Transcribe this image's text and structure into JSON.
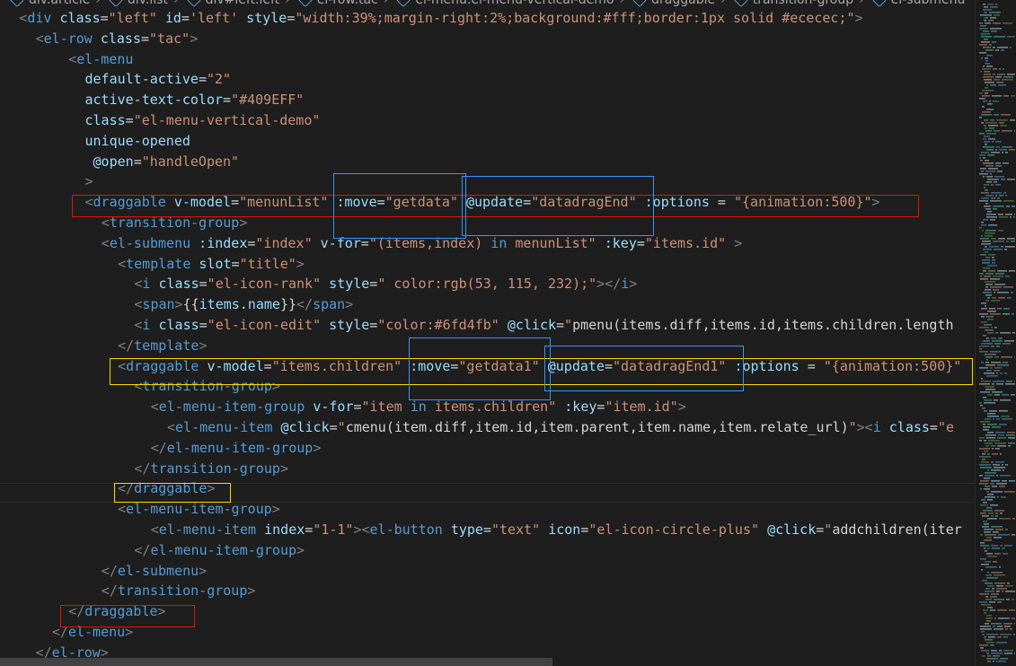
{
  "breadcrumb": [
    "div.article",
    "div.list",
    "div#left.left",
    "el-row.tac",
    "el-menu.el-menu-vertical-demo",
    "draggable",
    "transition-group",
    "el-submenu"
  ],
  "colors": {
    "tag": "#569cd6",
    "attr": "#9cdcfe",
    "string": "#ce9178",
    "punct": "#808080",
    "text": "#d4d4d4",
    "highlight_red": "#e51400",
    "highlight_blue": "#3794ff",
    "highlight_yellow": "#ffd700"
  },
  "code": [
    {
      "i": 1,
      "tokens": [
        [
          "p",
          "<"
        ],
        [
          "t",
          "div"
        ],
        [
          "d",
          " "
        ],
        [
          "a",
          "class"
        ],
        [
          "d",
          "="
        ],
        [
          "s",
          "\"left\""
        ],
        [
          "d",
          " "
        ],
        [
          "a",
          "id"
        ],
        [
          "d",
          "="
        ],
        [
          "s",
          "'left'"
        ],
        [
          "d",
          " "
        ],
        [
          "a",
          "style"
        ],
        [
          "d",
          "="
        ],
        [
          "s",
          "\"width:39%;margin-right:2%;background:#fff;border:1px solid #ececec;\""
        ],
        [
          "p",
          ">"
        ]
      ]
    },
    {
      "i": 2,
      "tokens": [
        [
          "p",
          "<"
        ],
        [
          "t",
          "el-row"
        ],
        [
          "d",
          " "
        ],
        [
          "a",
          "class"
        ],
        [
          "d",
          "="
        ],
        [
          "s",
          "\"tac\""
        ],
        [
          "p",
          ">"
        ]
      ]
    },
    {
      "i": 4,
      "tokens": [
        [
          "p",
          "<"
        ],
        [
          "t",
          "el-menu"
        ]
      ]
    },
    {
      "i": 5,
      "tokens": [
        [
          "a",
          "default-active"
        ],
        [
          "d",
          "="
        ],
        [
          "s",
          "\"2\""
        ]
      ]
    },
    {
      "i": 5,
      "tokens": [
        [
          "a",
          "active-text-color"
        ],
        [
          "d",
          "="
        ],
        [
          "s",
          "\"#409EFF\""
        ]
      ]
    },
    {
      "i": 5,
      "tokens": [
        [
          "a",
          "class"
        ],
        [
          "d",
          "="
        ],
        [
          "s",
          "\"el-menu-vertical-demo\""
        ]
      ]
    },
    {
      "i": 5,
      "tokens": [
        [
          "a",
          "unique-opened"
        ]
      ]
    },
    {
      "i": 5,
      "tokens": [
        [
          "d",
          " "
        ],
        [
          "a",
          "@open"
        ],
        [
          "d",
          "="
        ],
        [
          "s",
          "\"handleOpen\""
        ]
      ]
    },
    {
      "i": 5,
      "tokens": [
        [
          "p",
          ">"
        ]
      ]
    },
    {
      "i": 5,
      "tokens": [
        [
          "p",
          "<"
        ],
        [
          "t",
          "draggable"
        ],
        [
          "d",
          " "
        ],
        [
          "a",
          "v-model"
        ],
        [
          "d",
          "="
        ],
        [
          "s",
          "\"menunList\""
        ],
        [
          "d",
          " "
        ],
        [
          "a",
          ":move"
        ],
        [
          "d",
          "="
        ],
        [
          "s",
          "\"getdata\""
        ],
        [
          "d",
          " "
        ],
        [
          "a",
          "@update"
        ],
        [
          "d",
          "="
        ],
        [
          "s",
          "\"datadragEnd\""
        ],
        [
          "d",
          " "
        ],
        [
          "a",
          ":options"
        ],
        [
          "d",
          " = "
        ],
        [
          "s",
          "\"{animation:500}\""
        ],
        [
          "p",
          ">"
        ]
      ]
    },
    {
      "i": 6,
      "tokens": [
        [
          "p",
          "<"
        ],
        [
          "t",
          "transition-group"
        ],
        [
          "p",
          ">"
        ]
      ]
    },
    {
      "i": 6,
      "tokens": [
        [
          "p",
          "<"
        ],
        [
          "t",
          "el-submenu"
        ],
        [
          "d",
          " "
        ],
        [
          "a",
          ":index"
        ],
        [
          "d",
          "="
        ],
        [
          "s",
          "\"index\""
        ],
        [
          "d",
          " "
        ],
        [
          "a",
          "v-for"
        ],
        [
          "d",
          "="
        ],
        [
          "s",
          "\"(items,index) "
        ],
        [
          "t",
          "in"
        ],
        [
          "s",
          " menunList\""
        ],
        [
          "d",
          " "
        ],
        [
          "a",
          ":key"
        ],
        [
          "d",
          "="
        ],
        [
          "s",
          "\"items.id\""
        ],
        [
          "d",
          " "
        ],
        [
          "p",
          ">"
        ]
      ]
    },
    {
      "i": 7,
      "tokens": [
        [
          "p",
          "<"
        ],
        [
          "t",
          "template"
        ],
        [
          "d",
          " "
        ],
        [
          "a",
          "slot"
        ],
        [
          "d",
          "="
        ],
        [
          "s",
          "\"title\""
        ],
        [
          "p",
          ">"
        ]
      ]
    },
    {
      "i": 8,
      "tokens": [
        [
          "p",
          "<"
        ],
        [
          "t",
          "i"
        ],
        [
          "d",
          " "
        ],
        [
          "a",
          "class"
        ],
        [
          "d",
          "="
        ],
        [
          "s",
          "\"el-icon-rank\""
        ],
        [
          "d",
          " "
        ],
        [
          "a",
          "style"
        ],
        [
          "d",
          "="
        ],
        [
          "s",
          "\" color:rgb(53, 115, 232);\""
        ],
        [
          "p",
          "></"
        ],
        [
          "t",
          "i"
        ],
        [
          "p",
          ">"
        ]
      ]
    },
    {
      "i": 8,
      "tokens": [
        [
          "p",
          "<"
        ],
        [
          "t",
          "span"
        ],
        [
          "p",
          ">"
        ],
        [
          "d",
          "{{"
        ],
        [
          "a",
          "items.name"
        ],
        [
          "d",
          "}}"
        ],
        [
          "p",
          "</"
        ],
        [
          "t",
          "span"
        ],
        [
          "p",
          ">"
        ]
      ]
    },
    {
      "i": 8,
      "tokens": [
        [
          "p",
          "<"
        ],
        [
          "t",
          "i"
        ],
        [
          "d",
          " "
        ],
        [
          "a",
          "class"
        ],
        [
          "d",
          "="
        ],
        [
          "s",
          "\"el-icon-edit\""
        ],
        [
          "d",
          " "
        ],
        [
          "a",
          "style"
        ],
        [
          "d",
          "="
        ],
        [
          "s",
          "\"color:#6fd4fb\""
        ],
        [
          "d",
          " "
        ],
        [
          "a",
          "@click"
        ],
        [
          "d",
          "="
        ],
        [
          "s",
          "\""
        ],
        [
          "d",
          "pmenu(items.diff,items.id,items.children.length"
        ]
      ]
    },
    {
      "i": 7,
      "tokens": [
        [
          "p",
          "</"
        ],
        [
          "t",
          "template"
        ],
        [
          "p",
          ">"
        ]
      ]
    },
    {
      "i": 7,
      "tokens": [
        [
          "p",
          "<"
        ],
        [
          "t",
          "draggable"
        ],
        [
          "d",
          " "
        ],
        [
          "a",
          "v-model"
        ],
        [
          "d",
          "="
        ],
        [
          "s",
          "\"items.children\""
        ],
        [
          "d",
          " "
        ],
        [
          "a",
          ":move"
        ],
        [
          "d",
          "="
        ],
        [
          "s",
          "\"getdata1\""
        ],
        [
          "d",
          " "
        ],
        [
          "a",
          "@update"
        ],
        [
          "d",
          "="
        ],
        [
          "s",
          "\"datadragEnd1\""
        ],
        [
          "d",
          " "
        ],
        [
          "a",
          ":options"
        ],
        [
          "d",
          " = "
        ],
        [
          "s",
          "\"{animation:500}\""
        ]
      ]
    },
    {
      "i": 8,
      "tokens": [
        [
          "p",
          "<"
        ],
        [
          "t",
          "transition-group"
        ],
        [
          "p",
          ">"
        ]
      ]
    },
    {
      "i": 9,
      "tokens": [
        [
          "p",
          "<"
        ],
        [
          "t",
          "el-menu-item-group"
        ],
        [
          "d",
          " "
        ],
        [
          "a",
          "v-for"
        ],
        [
          "d",
          "="
        ],
        [
          "s",
          "\"item "
        ],
        [
          "t",
          "in"
        ],
        [
          "s",
          " items.children\""
        ],
        [
          "d",
          " "
        ],
        [
          "a",
          ":key"
        ],
        [
          "d",
          "="
        ],
        [
          "s",
          "\"item.id\""
        ],
        [
          "p",
          ">"
        ]
      ]
    },
    {
      "i": 10,
      "tokens": [
        [
          "p",
          "<"
        ],
        [
          "t",
          "el-menu-item"
        ],
        [
          "d",
          " "
        ],
        [
          "a",
          "@click"
        ],
        [
          "d",
          "="
        ],
        [
          "s",
          "\""
        ],
        [
          "d",
          "cmenu(item.diff,item.id,item.parent,item.name,item.relate_url)"
        ],
        [
          "s",
          "\""
        ],
        [
          "p",
          "><"
        ],
        [
          "t",
          "i"
        ],
        [
          "d",
          " "
        ],
        [
          "a",
          "class"
        ],
        [
          "d",
          "="
        ],
        [
          "s",
          "\"e"
        ]
      ]
    },
    {
      "i": 9,
      "tokens": [
        [
          "p",
          "</"
        ],
        [
          "t",
          "el-menu-item-group"
        ],
        [
          "p",
          ">"
        ]
      ]
    },
    {
      "i": 8,
      "tokens": [
        [
          "p",
          "</"
        ],
        [
          "t",
          "transition-group"
        ],
        [
          "p",
          ">"
        ]
      ]
    },
    {
      "i": 7,
      "tokens": [
        [
          "p",
          "</"
        ],
        [
          "t",
          "draggable"
        ],
        [
          "p",
          ">"
        ]
      ]
    },
    {
      "i": 7,
      "tokens": [
        [
          "p",
          "<"
        ],
        [
          "t",
          "el-menu-item-group"
        ],
        [
          "p",
          ">"
        ]
      ]
    },
    {
      "i": 9,
      "tokens": [
        [
          "p",
          "<"
        ],
        [
          "t",
          "el-menu-item"
        ],
        [
          "d",
          " "
        ],
        [
          "a",
          "index"
        ],
        [
          "d",
          "="
        ],
        [
          "s",
          "\"1-1\""
        ],
        [
          "p",
          "><"
        ],
        [
          "t",
          "el-button"
        ],
        [
          "d",
          " "
        ],
        [
          "a",
          "type"
        ],
        [
          "d",
          "="
        ],
        [
          "s",
          "\"text\""
        ],
        [
          "d",
          " "
        ],
        [
          "a",
          "icon"
        ],
        [
          "d",
          "="
        ],
        [
          "s",
          "\"el-icon-circle-plus\""
        ],
        [
          "d",
          " "
        ],
        [
          "a",
          "@click"
        ],
        [
          "d",
          "="
        ],
        [
          "s",
          "\""
        ],
        [
          "d",
          "addchildren(iter"
        ]
      ]
    },
    {
      "i": 8,
      "tokens": [
        [
          "p",
          "</"
        ],
        [
          "t",
          "el-menu-item-group"
        ],
        [
          "p",
          ">"
        ]
      ]
    },
    {
      "i": 6,
      "tokens": [
        [
          "p",
          "</"
        ],
        [
          "t",
          "el-submenu"
        ],
        [
          "p",
          ">"
        ]
      ]
    },
    {
      "i": 6,
      "tokens": [
        [
          "p",
          "</"
        ],
        [
          "t",
          "transition-group"
        ],
        [
          "p",
          ">"
        ]
      ]
    },
    {
      "i": 4,
      "tokens": [
        [
          "p",
          "</"
        ],
        [
          "t",
          "draggable"
        ],
        [
          "p",
          ">"
        ]
      ]
    },
    {
      "i": 3,
      "tokens": [
        [
          "p",
          "</"
        ],
        [
          "t",
          "el-menu"
        ],
        [
          "p",
          ">"
        ]
      ]
    },
    {
      "i": 2,
      "tokens": [
        [
          "p",
          "</"
        ],
        [
          "t",
          "el-row"
        ],
        [
          "p",
          ">"
        ]
      ]
    }
  ]
}
